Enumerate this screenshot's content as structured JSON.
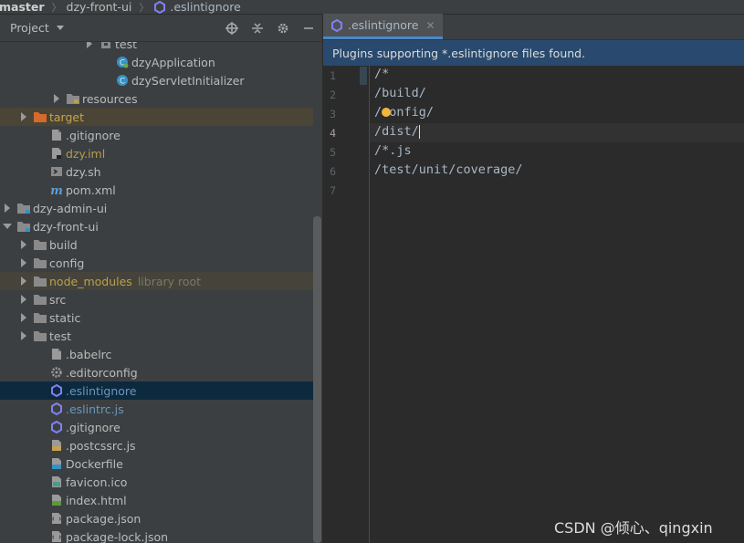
{
  "breadcrumb": {
    "items": [
      "master",
      "dzy-front-ui"
    ],
    "file": ".eslintignore"
  },
  "project_panel": {
    "title": "Project",
    "toolbar_icons": [
      "locate-icon",
      "collapse-icon",
      "gear-icon",
      "minimize-icon"
    ]
  },
  "tree": [
    {
      "label": "test",
      "indent": 92,
      "arrow": "right",
      "icon": "package-icon",
      "style": "normal"
    },
    {
      "label": "dzyApplication",
      "indent": 110,
      "arrow": "none",
      "icon": "spring-class-icon",
      "style": "normal"
    },
    {
      "label": "dzyServletInitializer",
      "indent": 110,
      "arrow": "none",
      "icon": "class-icon",
      "style": "normal"
    },
    {
      "label": "resources",
      "indent": 56,
      "arrow": "right",
      "icon": "resources-folder-icon",
      "style": "normal"
    },
    {
      "label": "target",
      "indent": 20,
      "arrow": "right",
      "icon": "excluded-folder-icon",
      "style": "orange",
      "row": "hl"
    },
    {
      "label": ".gitignore",
      "indent": 38,
      "arrow": "none",
      "icon": "file-icon",
      "style": "normal"
    },
    {
      "label": "dzy.iml",
      "indent": 38,
      "arrow": "none",
      "icon": "iml-icon",
      "style": "ignored"
    },
    {
      "label": "dzy.sh",
      "indent": 38,
      "arrow": "none",
      "icon": "shell-icon",
      "style": "normal"
    },
    {
      "label": "pom.xml",
      "indent": 38,
      "arrow": "none",
      "icon": "maven-icon",
      "style": "normal"
    },
    {
      "label": "dzy-admin-ui",
      "indent": 2,
      "arrow": "right",
      "icon": "module-folder-icon",
      "style": "normal"
    },
    {
      "label": "dzy-front-ui",
      "indent": 2,
      "arrow": "down",
      "icon": "module-folder-icon",
      "style": "normal"
    },
    {
      "label": "build",
      "indent": 20,
      "arrow": "right",
      "icon": "folder-icon",
      "style": "normal"
    },
    {
      "label": "config",
      "indent": 20,
      "arrow": "right",
      "icon": "folder-icon",
      "style": "normal"
    },
    {
      "label": "node_modules",
      "indent": 20,
      "arrow": "right",
      "icon": "library-folder-icon",
      "style": "folder-lib",
      "row": "hl2",
      "suffix": "library root"
    },
    {
      "label": "src",
      "indent": 20,
      "arrow": "right",
      "icon": "folder-icon",
      "style": "normal"
    },
    {
      "label": "static",
      "indent": 20,
      "arrow": "right",
      "icon": "folder-icon",
      "style": "normal"
    },
    {
      "label": "test",
      "indent": 20,
      "arrow": "right",
      "icon": "folder-icon",
      "style": "normal"
    },
    {
      "label": ".babelrc",
      "indent": 38,
      "arrow": "none",
      "icon": "file-icon",
      "style": "normal"
    },
    {
      "label": ".editorconfig",
      "indent": 38,
      "arrow": "none",
      "icon": "gear-file-icon",
      "style": "normal"
    },
    {
      "label": ".eslintignore",
      "indent": 38,
      "arrow": "none",
      "icon": "eslint-icon",
      "style": "blue",
      "row": "sel"
    },
    {
      "label": ".eslintrc.js",
      "indent": 38,
      "arrow": "none",
      "icon": "eslint-icon",
      "style": "blue"
    },
    {
      "label": ".gitignore",
      "indent": 38,
      "arrow": "none",
      "icon": "eslint-icon",
      "style": "normal"
    },
    {
      "label": ".postcssrc.js",
      "indent": 38,
      "arrow": "none",
      "icon": "js-icon",
      "style": "normal"
    },
    {
      "label": "Dockerfile",
      "indent": 38,
      "arrow": "none",
      "icon": "docker-icon",
      "style": "normal"
    },
    {
      "label": "favicon.ico",
      "indent": 38,
      "arrow": "none",
      "icon": "image-icon",
      "style": "normal"
    },
    {
      "label": "index.html",
      "indent": 38,
      "arrow": "none",
      "icon": "html-icon",
      "style": "normal"
    },
    {
      "label": "package.json",
      "indent": 38,
      "arrow": "none",
      "icon": "json-icon",
      "style": "normal"
    },
    {
      "label": "package-lock.json",
      "indent": 38,
      "arrow": "none",
      "icon": "json-icon",
      "style": "normal"
    }
  ],
  "editor": {
    "tab_label": ".eslintignore",
    "banner": "Plugins supporting *.eslintignore files found.",
    "lines": [
      "/*",
      "/build/",
      "/config/",
      "/dist/",
      "/*.js",
      "/test/unit/coverage/",
      ""
    ],
    "line_numbers": [
      "1",
      "2",
      "3",
      "4",
      "5",
      "6",
      "7"
    ],
    "current_line": 4
  },
  "watermark": "CSDN @倾心、qingxin",
  "colors": {
    "accent": "#4a88c7",
    "banner": "#294a6e",
    "selection": "#0d293e",
    "excluded": "#c8a34f"
  }
}
